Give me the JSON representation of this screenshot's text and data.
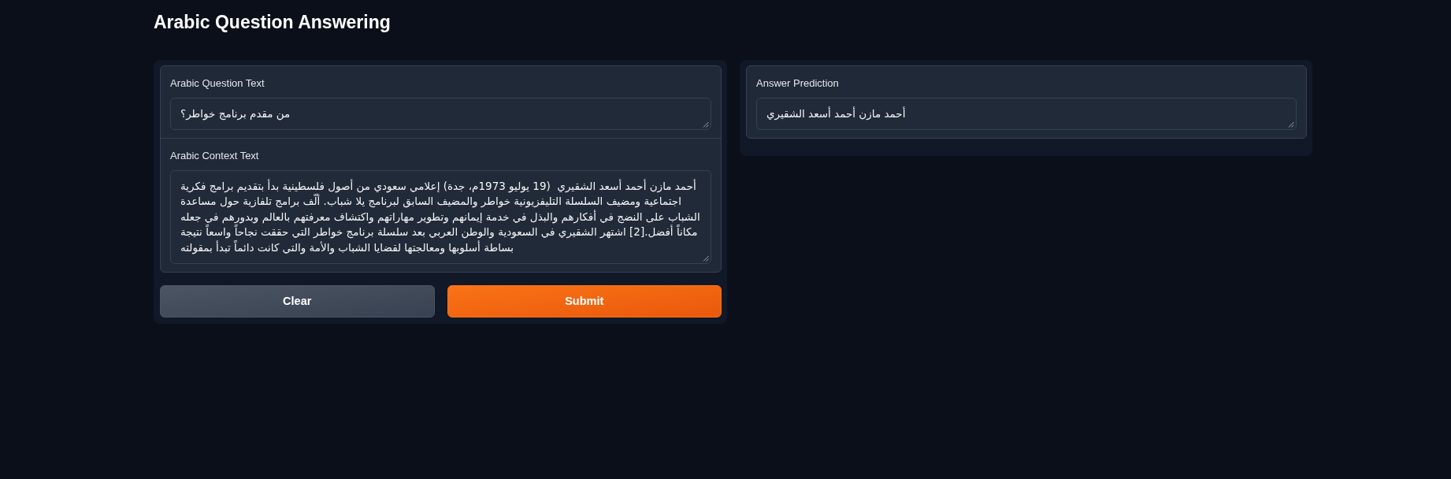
{
  "title": "Arabic Question Answering",
  "input_panel": {
    "fields": [
      {
        "label": "Arabic Question Text",
        "value": "من مقدم برنامج خواطر؟"
      },
      {
        "label": "Arabic Context Text",
        "value": "أحمد مازن أحمد أسعد الشقيري  (19 يوليو 1973م، جدة) إعلامي سعودي من أصول فلسطينية بدأ بتقديم برامج فكرية اجتماعية ومضيف السلسلة التليفزيونية خواطر والمضيف السابق لبرنامج يلا شباب. ألّف برامج تلفازية حول مساعدة الشباب على النضج في أفكارهم والبذل في خدمة إيمانهم وتطوير مهاراتهم واكتشاف معرفتهم بالعالم وبدورهم في جعله مكاناً أفضل.[2] اشتهر الشقيري في السعودية والوطن العربي بعد سلسلة برنامج خواطر التي حققت نجاحاً واسعاً نتيجة بساطة أسلوبها ومعالجتها لقضايا الشباب والأمة والتي كانت دائماً تبدأ بمقولته"
      }
    ],
    "clear_button": {
      "label": "Clear"
    },
    "submit_button": {
      "label": "Submit"
    }
  },
  "output_panel": {
    "fields": [
      {
        "label": "Answer Prediction",
        "value": "أحمد مازن أحمد أسعد الشقيري"
      }
    ]
  }
}
